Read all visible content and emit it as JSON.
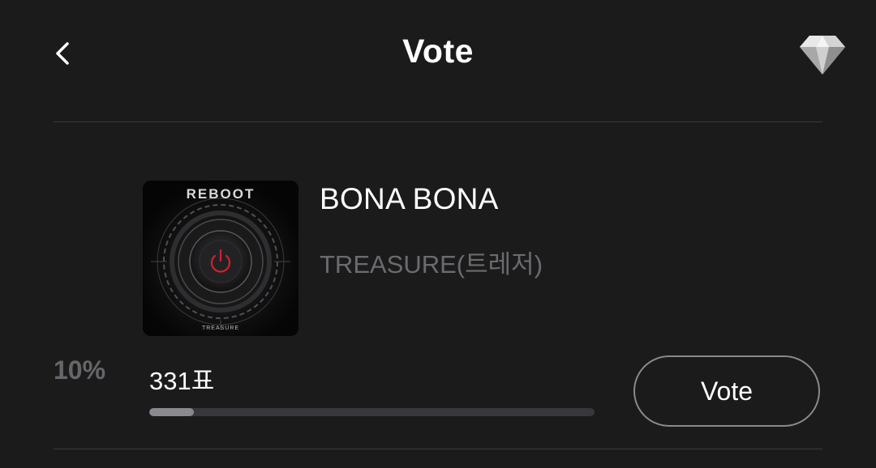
{
  "header": {
    "title": "Vote",
    "back_icon": "chevron-left-icon",
    "gem_icon": "diamond-icon"
  },
  "vote_items": [
    {
      "album_text": "REBOOT",
      "album_subtext": "TREASURE",
      "song_title": "BONA BONA",
      "artist": "TREASURE(트레저)",
      "percent_label": "10%",
      "votes_label": "331표",
      "progress": 0.1,
      "vote_button_label": "Vote"
    }
  ],
  "colors": {
    "background": "#1b1b1c",
    "divider": "#3a3a3c",
    "muted_text": "#6b6b6f",
    "progress_fill": "#8a8a8e",
    "progress_track": "#38383c",
    "power_icon_red": "#d0222a"
  }
}
